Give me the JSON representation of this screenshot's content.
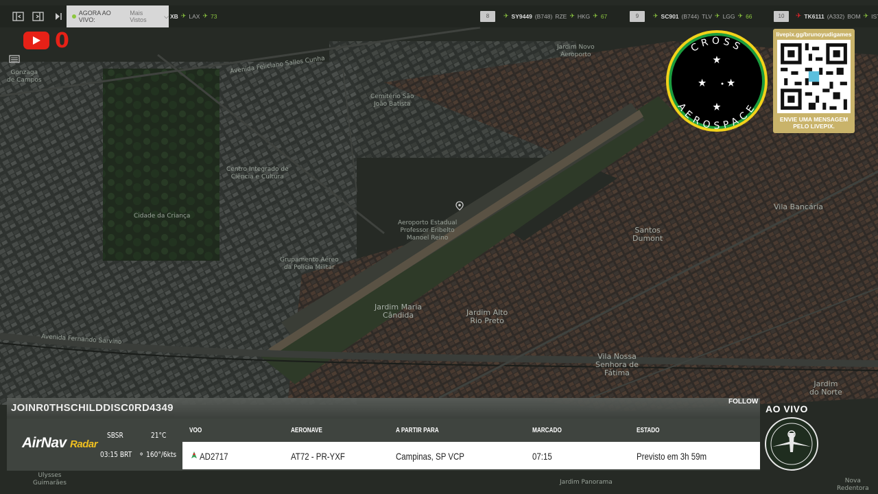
{
  "topbar": {
    "live_label": "AGORA AO VIVO:",
    "live_selection": "Mais Vistos",
    "ticker": [
      {
        "index": "",
        "code": "XB",
        "route_from": "",
        "route_to": "LAX",
        "value": "73"
      },
      {
        "index": "8",
        "code": "SY9449",
        "extra": "(B748)",
        "route_from": "RZE",
        "route_to": "HKG",
        "value": "67"
      },
      {
        "index": "9",
        "code": "SC901",
        "extra": "(B744)",
        "route_from": "TLV",
        "route_to": "LGG",
        "value": "66"
      },
      {
        "index": "10",
        "code": "TK6111",
        "extra": "(A332)",
        "route_from": "BOM",
        "route_to": "IST",
        "value": ""
      }
    ]
  },
  "youtube": {
    "count": "0"
  },
  "map_labels": {
    "gonzaga": "Gonzaga\nde Campos",
    "jardim_novo": "Jardim Novo\nAeroporto",
    "av_feliciano": "Avenida Feliciano Salles Cunha",
    "cemiterio": "Cemitério São\nJoão Batista",
    "centro_integrado": "Centro Integrado de\nCiência e Cultura",
    "cidade_crianca": "Cidade da Criança",
    "aeroporto_estadual": "Aeroporto Estadual\nProfessor Eribelto\nManoel Reino",
    "grupamento": "Grupamento Aéreo\nda Polícia Militar",
    "jardim_maria_candida": "Jardim Maria\nCândida",
    "jardim_alto": "Jardim Alto\nRio Preto",
    "santos_dumont": "Santos\nDumont",
    "vila_bancaria": "Vila Bancária",
    "vila_nossa": "Vila Nossa\nSenhora de\nFátima",
    "jardim_norte": "Jardim\ndo Norte",
    "av_fernando": "Avenida Fernando Sarvino",
    "jardim_panorama": "Jardim Panorama",
    "nova_redentora": "Nova\nRedentora",
    "ulysses": "Ulysses\nGuimarães"
  },
  "logos": {
    "cross_top": "CROSS",
    "cross_bottom": "AEROSPACE",
    "qr_url": "livepix.gg/brunoyudigames",
    "qr_message_line1": "ENVIE UMA MENSAGEM",
    "qr_message_line2": "PELO LIVEPIX."
  },
  "overlay": {
    "follow": "FOLLOW",
    "ao_vivo": "AO VIVO",
    "channel_name": "JOINR0THSCHILDDISC0RD4349",
    "airnav_brand": "AirNav",
    "airnav_product": "Radar",
    "airport_code": "SBSR",
    "temperature": "21°C",
    "local_time": "03:15 BRT",
    "wind": "160°/6kts",
    "columns": {
      "voo": "VOO",
      "aeronave": "AERONAVE",
      "partir": "A PARTIR PARA",
      "marcado": "MARCADO",
      "estado": "ESTADO"
    },
    "flight": {
      "voo": "AD2717",
      "aeronave": "AT72 - PR-YXF",
      "partir": "Campinas, SP VCP",
      "marcado": "07:15",
      "estado": "Previsto em 3h 59m"
    }
  },
  "colors": {
    "accent_green": "#8cc63f",
    "youtube_red": "#e62117",
    "qr_gold": "#c9b36a",
    "airnav_yellow": "#f0c020"
  }
}
